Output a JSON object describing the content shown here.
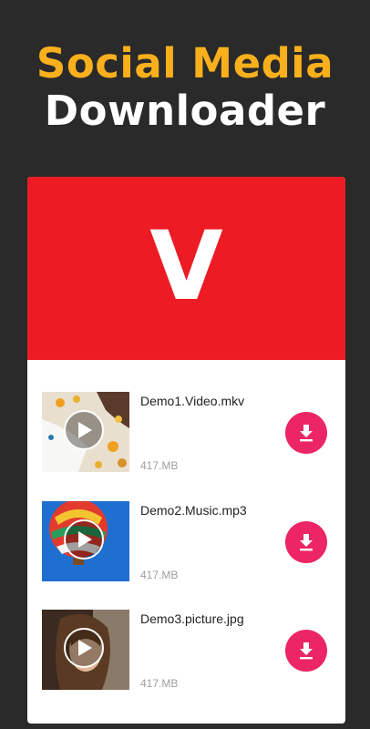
{
  "headline": {
    "line1": "Social Media",
    "line2": "Downloader"
  },
  "banner": {
    "logo": "V"
  },
  "files": [
    {
      "name": "Demo1.Video.mkv",
      "size": "417.MB",
      "thumb": "food-flatlay"
    },
    {
      "name": "Demo2.Music.mp3",
      "size": "417.MB",
      "thumb": "hot-air-balloon"
    },
    {
      "name": "Demo3.picture.jpg",
      "size": "417.MB",
      "thumb": "portrait-woman"
    }
  ],
  "colors": {
    "background": "#2a2a2a",
    "accent": "#f9b01c",
    "banner": "#ed1c24",
    "download": "#ec2564"
  }
}
